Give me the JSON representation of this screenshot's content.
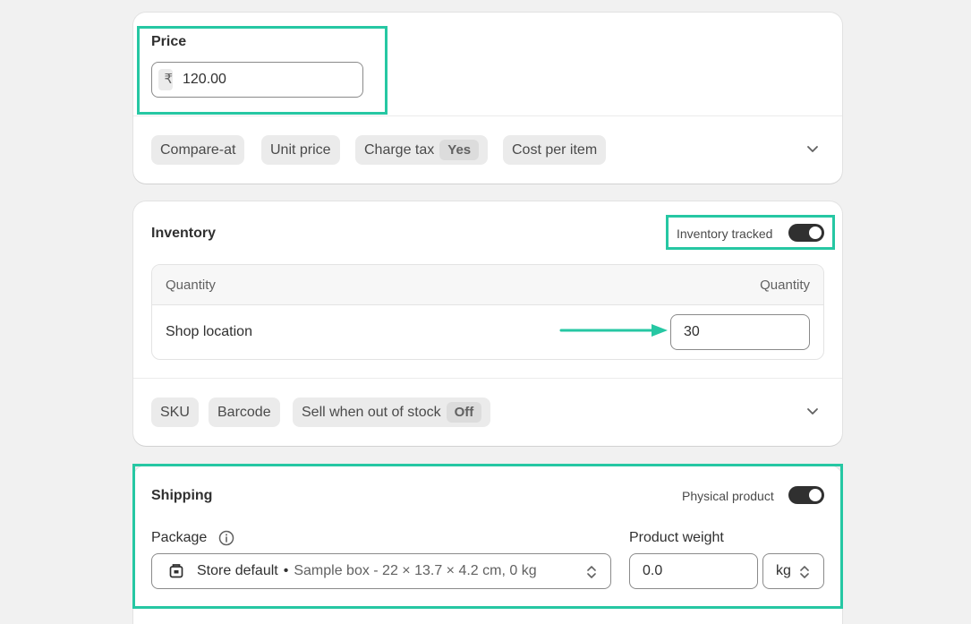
{
  "price": {
    "title": "Price",
    "currency_symbol": "₹",
    "value": "120.00",
    "pills": {
      "compare_at": "Compare-at",
      "unit_price": "Unit price",
      "charge_tax": "Charge tax",
      "charge_tax_value": "Yes",
      "cost_per_item": "Cost per item"
    }
  },
  "inventory": {
    "title": "Inventory",
    "tracked_label": "Inventory tracked",
    "tracked_on": true,
    "table": {
      "col_left": "Quantity",
      "col_right": "Quantity",
      "rows": [
        {
          "location": "Shop location",
          "quantity": "30"
        }
      ]
    },
    "pills": {
      "sku": "SKU",
      "barcode": "Barcode",
      "sell_out_of_stock": "Sell when out of stock",
      "sell_out_of_stock_value": "Off"
    }
  },
  "shipping": {
    "title": "Shipping",
    "physical_label": "Physical product",
    "physical_on": true,
    "package_label": "Package",
    "package_name": "Store default",
    "package_sep": "•",
    "package_detail": "Sample box - 22 × 13.7 × 4.2 cm, 0 kg",
    "weight_label": "Product weight",
    "weight_value": "0.0",
    "weight_unit": "kg"
  },
  "colors": {
    "highlight": "#26c7a3",
    "toggle_on": "#303030"
  }
}
